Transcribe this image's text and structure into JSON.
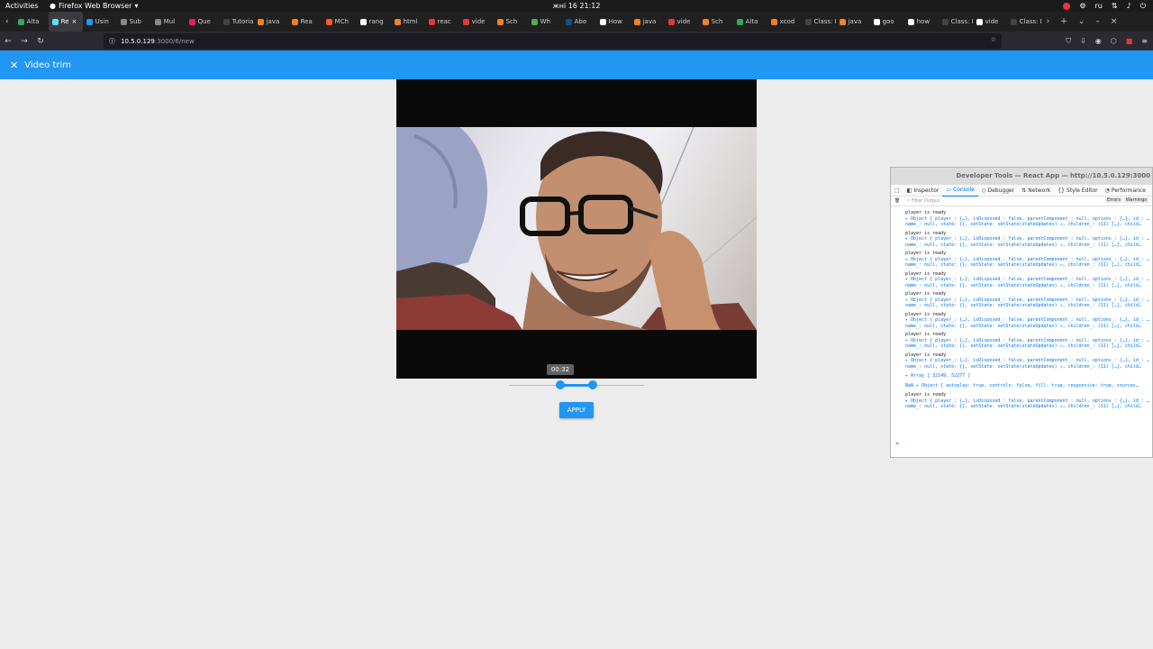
{
  "os": {
    "activities": "Activities",
    "app_name": "Firefox Web Browser",
    "clock": "жні 16  21:12",
    "lang": "ru"
  },
  "tabs": [
    {
      "label": "Alta",
      "color": "#3aa757"
    },
    {
      "label": "Re",
      "color": "#61dafb"
    },
    {
      "label": "Usin",
      "color": "#2196f3"
    },
    {
      "label": "Sub",
      "color": "#888888"
    },
    {
      "label": "Mul",
      "color": "#888888"
    },
    {
      "label": "Que",
      "color": "#e91e63"
    },
    {
      "label": "Tutorial",
      "color": "#444444"
    },
    {
      "label": "java",
      "color": "#f48024"
    },
    {
      "label": "Rea",
      "color": "#f48024"
    },
    {
      "label": "MCh",
      "color": "#ff5722"
    },
    {
      "label": "rang",
      "color": "#ffffff"
    },
    {
      "label": "html",
      "color": "#f48024"
    },
    {
      "label": "reac",
      "color": "#e53935"
    },
    {
      "label": "vide",
      "color": "#e53935"
    },
    {
      "label": "Sch",
      "color": "#f48024"
    },
    {
      "label": "Wh",
      "color": "#4caf50"
    },
    {
      "label": "Abo",
      "color": "#0b5394"
    },
    {
      "label": "How",
      "color": "#ffffff"
    },
    {
      "label": "java",
      "color": "#f48024"
    },
    {
      "label": "vide",
      "color": "#e53935"
    },
    {
      "label": "Sch",
      "color": "#f48024"
    },
    {
      "label": "Alta",
      "color": "#3aa757"
    },
    {
      "label": "xcod",
      "color": "#f48024"
    },
    {
      "label": "Class: L",
      "color": "#444444"
    },
    {
      "label": "java",
      "color": "#f48024"
    },
    {
      "label": "goo",
      "color": "#ffffff"
    },
    {
      "label": "how",
      "color": "#ffffff"
    },
    {
      "label": "Class: H",
      "color": "#444444"
    },
    {
      "label": "vide",
      "color": "#ffffff"
    },
    {
      "label": "Class: P",
      "color": "#444444"
    }
  ],
  "url": {
    "host": "10.5.0.129",
    "path": ":3000/6/new"
  },
  "app": {
    "title": "Video trim",
    "apply_label": "APPLY",
    "tooltip": "00:32",
    "trim_start": 0.38,
    "trim_end": 0.62
  },
  "devtools": {
    "title": "Developer Tools — React App — http://10.5.0.129:3000",
    "tabs": [
      "Inspector",
      "Console",
      "Debugger",
      "Network",
      "Style Editor",
      "Performance"
    ],
    "filter_placeholder": "Filter Output",
    "filter_buttons": [
      "Errors",
      "Warnings"
    ],
    "log_ready": "player is ready",
    "log_obj1": "▸ Object { player_: {…}, isDisposed_: false, parentComponent_: null, options_: {…}, id_: …",
    "log_obj2": "name_: null, state: {}, setState: setState(stateUpdates) ↗, children_: (11) […], child…",
    "log_array": "▸ Array [ 32149, 52277 ]",
    "log_nan": "NaN ▸ Object { autoplay: true, controls: false, fill: true, responsive: true, sources…",
    "prompt": "»"
  }
}
